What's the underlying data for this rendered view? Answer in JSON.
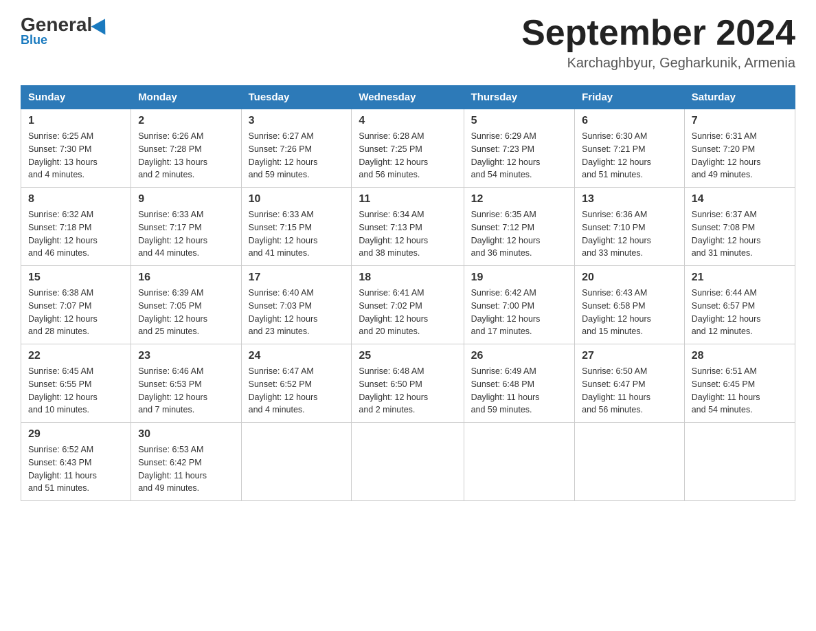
{
  "logo": {
    "general": "General",
    "blue": "Blue"
  },
  "header": {
    "month": "September 2024",
    "location": "Karchaghbyur, Gegharkunik, Armenia"
  },
  "weekdays": [
    "Sunday",
    "Monday",
    "Tuesday",
    "Wednesday",
    "Thursday",
    "Friday",
    "Saturday"
  ],
  "weeks": [
    [
      {
        "day": "1",
        "sunrise": "6:25 AM",
        "sunset": "7:30 PM",
        "daylight": "13 hours and 4 minutes."
      },
      {
        "day": "2",
        "sunrise": "6:26 AM",
        "sunset": "7:28 PM",
        "daylight": "13 hours and 2 minutes."
      },
      {
        "day": "3",
        "sunrise": "6:27 AM",
        "sunset": "7:26 PM",
        "daylight": "12 hours and 59 minutes."
      },
      {
        "day": "4",
        "sunrise": "6:28 AM",
        "sunset": "7:25 PM",
        "daylight": "12 hours and 56 minutes."
      },
      {
        "day": "5",
        "sunrise": "6:29 AM",
        "sunset": "7:23 PM",
        "daylight": "12 hours and 54 minutes."
      },
      {
        "day": "6",
        "sunrise": "6:30 AM",
        "sunset": "7:21 PM",
        "daylight": "12 hours and 51 minutes."
      },
      {
        "day": "7",
        "sunrise": "6:31 AM",
        "sunset": "7:20 PM",
        "daylight": "12 hours and 49 minutes."
      }
    ],
    [
      {
        "day": "8",
        "sunrise": "6:32 AM",
        "sunset": "7:18 PM",
        "daylight": "12 hours and 46 minutes."
      },
      {
        "day": "9",
        "sunrise": "6:33 AM",
        "sunset": "7:17 PM",
        "daylight": "12 hours and 44 minutes."
      },
      {
        "day": "10",
        "sunrise": "6:33 AM",
        "sunset": "7:15 PM",
        "daylight": "12 hours and 41 minutes."
      },
      {
        "day": "11",
        "sunrise": "6:34 AM",
        "sunset": "7:13 PM",
        "daylight": "12 hours and 38 minutes."
      },
      {
        "day": "12",
        "sunrise": "6:35 AM",
        "sunset": "7:12 PM",
        "daylight": "12 hours and 36 minutes."
      },
      {
        "day": "13",
        "sunrise": "6:36 AM",
        "sunset": "7:10 PM",
        "daylight": "12 hours and 33 minutes."
      },
      {
        "day": "14",
        "sunrise": "6:37 AM",
        "sunset": "7:08 PM",
        "daylight": "12 hours and 31 minutes."
      }
    ],
    [
      {
        "day": "15",
        "sunrise": "6:38 AM",
        "sunset": "7:07 PM",
        "daylight": "12 hours and 28 minutes."
      },
      {
        "day": "16",
        "sunrise": "6:39 AM",
        "sunset": "7:05 PM",
        "daylight": "12 hours and 25 minutes."
      },
      {
        "day": "17",
        "sunrise": "6:40 AM",
        "sunset": "7:03 PM",
        "daylight": "12 hours and 23 minutes."
      },
      {
        "day": "18",
        "sunrise": "6:41 AM",
        "sunset": "7:02 PM",
        "daylight": "12 hours and 20 minutes."
      },
      {
        "day": "19",
        "sunrise": "6:42 AM",
        "sunset": "7:00 PM",
        "daylight": "12 hours and 17 minutes."
      },
      {
        "day": "20",
        "sunrise": "6:43 AM",
        "sunset": "6:58 PM",
        "daylight": "12 hours and 15 minutes."
      },
      {
        "day": "21",
        "sunrise": "6:44 AM",
        "sunset": "6:57 PM",
        "daylight": "12 hours and 12 minutes."
      }
    ],
    [
      {
        "day": "22",
        "sunrise": "6:45 AM",
        "sunset": "6:55 PM",
        "daylight": "12 hours and 10 minutes."
      },
      {
        "day": "23",
        "sunrise": "6:46 AM",
        "sunset": "6:53 PM",
        "daylight": "12 hours and 7 minutes."
      },
      {
        "day": "24",
        "sunrise": "6:47 AM",
        "sunset": "6:52 PM",
        "daylight": "12 hours and 4 minutes."
      },
      {
        "day": "25",
        "sunrise": "6:48 AM",
        "sunset": "6:50 PM",
        "daylight": "12 hours and 2 minutes."
      },
      {
        "day": "26",
        "sunrise": "6:49 AM",
        "sunset": "6:48 PM",
        "daylight": "11 hours and 59 minutes."
      },
      {
        "day": "27",
        "sunrise": "6:50 AM",
        "sunset": "6:47 PM",
        "daylight": "11 hours and 56 minutes."
      },
      {
        "day": "28",
        "sunrise": "6:51 AM",
        "sunset": "6:45 PM",
        "daylight": "11 hours and 54 minutes."
      }
    ],
    [
      {
        "day": "29",
        "sunrise": "6:52 AM",
        "sunset": "6:43 PM",
        "daylight": "11 hours and 51 minutes."
      },
      {
        "day": "30",
        "sunrise": "6:53 AM",
        "sunset": "6:42 PM",
        "daylight": "11 hours and 49 minutes."
      },
      null,
      null,
      null,
      null,
      null
    ]
  ]
}
